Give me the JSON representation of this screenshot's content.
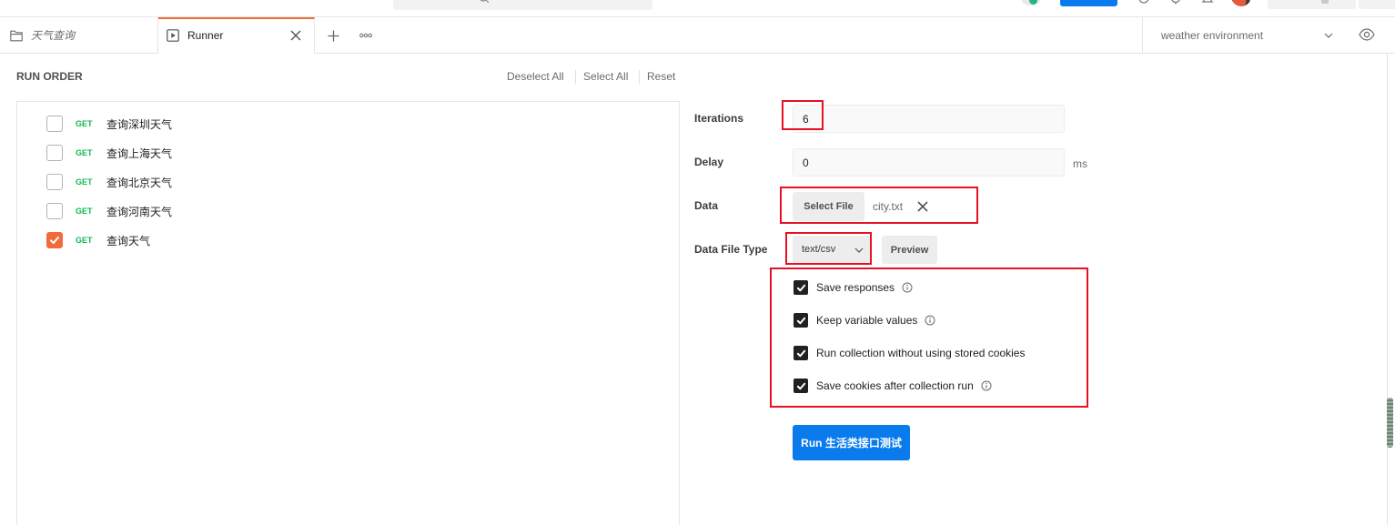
{
  "colors": {
    "accent": "#f26b3a",
    "primary_button": "#097bed",
    "get_method": "#0cbb52",
    "option_checkbox": "#212121",
    "annotation": "#e81123"
  },
  "header": {
    "icons": [
      "search-icon",
      "sync-status-icon",
      "capture-icon",
      "settings-icon",
      "notifications-icon",
      "user-avatar"
    ]
  },
  "tabs": [
    {
      "label": "天气查询",
      "icon": "folder-icon",
      "active": false
    },
    {
      "label": "Runner",
      "icon": "runner-icon",
      "active": true
    }
  ],
  "tab_actions": {
    "new_tab_icon": "plus-icon",
    "more_icon": "ellipsis-icon",
    "close_icon": "close-icon"
  },
  "environment": {
    "selected": "weather environment",
    "icons": [
      "chevron-down-icon",
      "eye-icon"
    ]
  },
  "run_order": {
    "title": "RUN ORDER",
    "actions": {
      "deselect_all": "Deselect All",
      "select_all": "Select All",
      "reset": "Reset"
    },
    "requests": [
      {
        "method": "GET",
        "name": "查询深圳天气",
        "checked": false
      },
      {
        "method": "GET",
        "name": "查询上海天气",
        "checked": false
      },
      {
        "method": "GET",
        "name": "查询北京天气",
        "checked": false
      },
      {
        "method": "GET",
        "name": "查询河南天气",
        "checked": false
      },
      {
        "method": "GET",
        "name": "查询天气",
        "checked": true
      }
    ]
  },
  "settings": {
    "iterations": {
      "label": "Iterations",
      "value": "6"
    },
    "delay": {
      "label": "Delay",
      "value": "0",
      "unit": "ms"
    },
    "data": {
      "label": "Data",
      "select_file_label": "Select File",
      "file_name": "city.txt"
    },
    "data_file_type": {
      "label": "Data File Type",
      "selected": "text/csv",
      "preview_label": "Preview"
    },
    "options": [
      {
        "label": "Save responses",
        "checked": true,
        "info": true
      },
      {
        "label": "Keep variable values",
        "checked": true,
        "info": true
      },
      {
        "label": "Run collection without using stored cookies",
        "checked": true,
        "info": false
      },
      {
        "label": "Save cookies after collection run",
        "checked": true,
        "info": true
      }
    ],
    "run_button_label": "Run 生活类接口测试"
  }
}
